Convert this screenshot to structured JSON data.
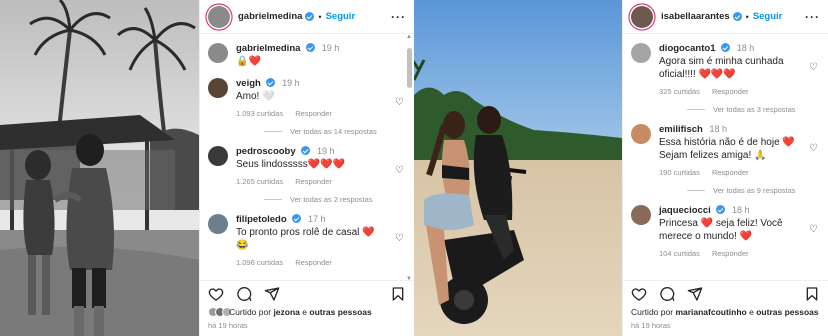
{
  "left_post": {
    "author": "gabrielmedina",
    "follow_label": "Seguir",
    "caption": {
      "user": "gabrielmedina",
      "time": "19 h",
      "text": "🔒❤️"
    },
    "comments": [
      {
        "user": "veigh",
        "time": "19 h",
        "text": "Amo! 🤍",
        "likes": "1.093 curtidas",
        "reply_label": "Responder",
        "view_replies": "Ver todas as 14 respostas"
      },
      {
        "user": "pedroscooby",
        "time": "19 h",
        "text": "Seus lindosssss❤️❤️❤️",
        "likes": "1.265 curtidas",
        "reply_label": "Responder",
        "view_replies": "Ver todas as 2 respostas"
      },
      {
        "user": "filipetoledo",
        "time": "17 h",
        "text": "To pronto pros rolê de casal ❤️😂",
        "likes": "1.096 curtidas",
        "reply_label": "Responder"
      }
    ],
    "liked_by": {
      "prefix": "Curtido por",
      "user": "jezona",
      "suffix": "e",
      "others": "outras pessoas"
    },
    "time_ago": "há 19 horas"
  },
  "right_post": {
    "author": "isabellaarantes",
    "follow_label": "Seguir",
    "comments": [
      {
        "user": "diogocanto1",
        "time": "18 h",
        "text": "Agora sim é minha cunhada oficial!!!! ❤️❤️❤️",
        "likes": "325 curtidas",
        "reply_label": "Responder",
        "view_replies": "Ver todas as 3 respostas"
      },
      {
        "user": "emilifisch",
        "time": "18 h",
        "text": "Essa história não é de hoje ❤️ Sejam felizes amiga! 🙏",
        "likes": "190 curtidas",
        "reply_label": "Responder",
        "view_replies": "Ver todas as 9 respostas"
      },
      {
        "user": "jaqueciocci",
        "time": "18 h",
        "text": "Princesa ❤️ seja feliz! Você merece o mundo! ❤️",
        "likes": "104 curtidas",
        "reply_label": "Responder"
      }
    ],
    "liked_by": {
      "prefix": "Curtido por",
      "user": "marianafcoutinho",
      "suffix": "e",
      "others": "outras pessoas"
    },
    "time_ago": "há 19 horas"
  },
  "icons": [
    "heart-icon",
    "comment-icon",
    "share-icon",
    "bookmark-icon",
    "more-icon",
    "verified-icon"
  ],
  "colors": {
    "link": "#0095f6",
    "verified": "#3897f0",
    "muted": "#8e8e8e",
    "story_ring": "#d62976"
  }
}
